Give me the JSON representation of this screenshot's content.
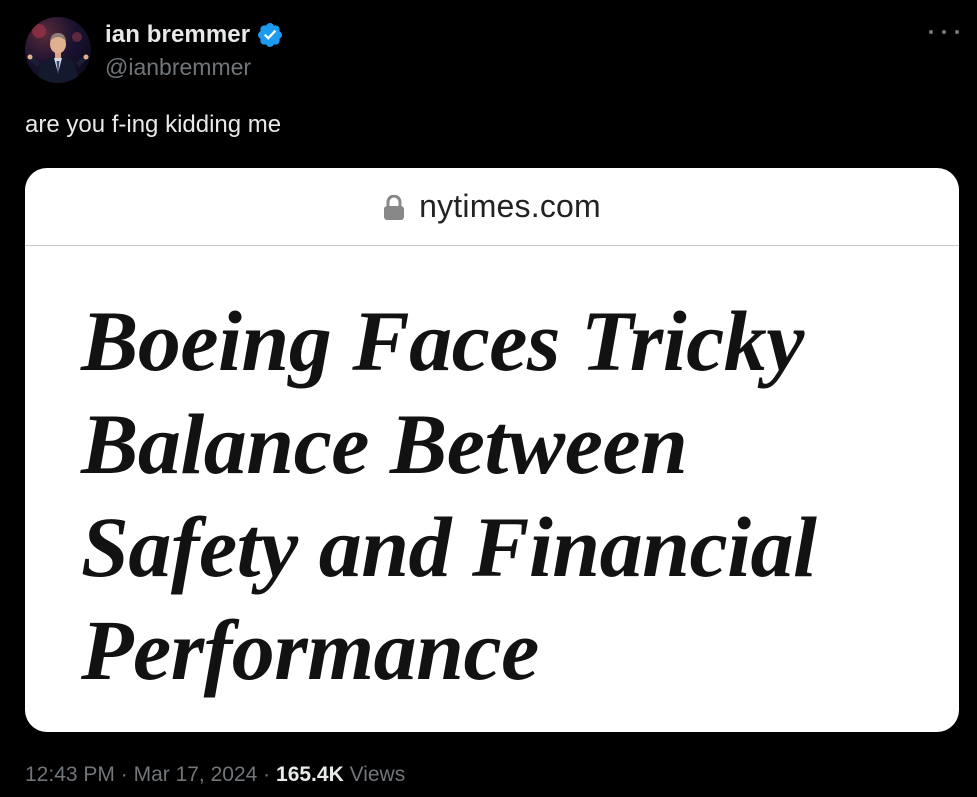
{
  "author": {
    "display_name": "ian bremmer",
    "handle": "@ianbremmer",
    "verified": true
  },
  "tweet": {
    "text": "are you f-ing kidding me"
  },
  "card": {
    "domain": "nytimes.com",
    "headline_lines": [
      "Boeing Faces Tricky",
      "Balance Between",
      "Safety and Financial",
      "Performance"
    ]
  },
  "meta": {
    "time": "12:43 PM",
    "separator": "·",
    "date": "Mar 17, 2024",
    "views_count": "165.4K",
    "views_label": "Views"
  },
  "colors": {
    "background": "#000000",
    "text_primary": "#e7e9ea",
    "text_secondary": "#71767b",
    "verified_badge": "#1d9bf0",
    "card_background": "#ffffff"
  },
  "icons": {
    "verified": "verified-badge-icon",
    "more": "more-horizontal-icon",
    "lock": "lock-icon"
  }
}
